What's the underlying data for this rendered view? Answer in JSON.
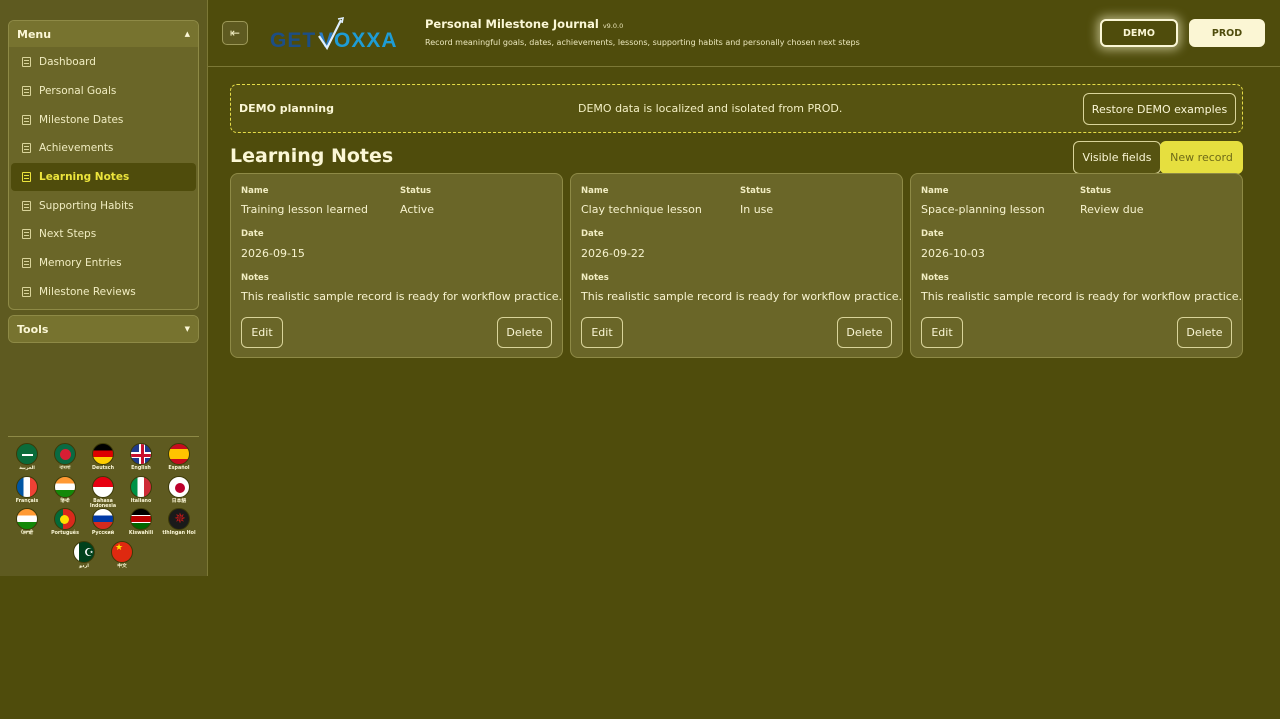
{
  "sidebar": {
    "menu_title": "Menu",
    "tools_title": "Tools",
    "items": [
      {
        "label": "Dashboard"
      },
      {
        "label": "Personal Goals"
      },
      {
        "label": "Milestone Dates"
      },
      {
        "label": "Achievements"
      },
      {
        "label": "Learning Notes",
        "active": true
      },
      {
        "label": "Supporting Habits"
      },
      {
        "label": "Next Steps"
      },
      {
        "label": "Memory Entries"
      },
      {
        "label": "Milestone Reviews"
      }
    ],
    "languages": [
      {
        "label": "العربية",
        "icon": "flag-saudi-arabia-icon"
      },
      {
        "label": "বাংলা",
        "icon": "flag-bangladesh-icon"
      },
      {
        "label": "Deutsch",
        "icon": "flag-germany-icon"
      },
      {
        "label": "English",
        "icon": "flag-uk-icon"
      },
      {
        "label": "Español",
        "icon": "flag-spain-icon"
      },
      {
        "label": "Français",
        "icon": "flag-france-icon"
      },
      {
        "label": "हिन्दी",
        "icon": "flag-india-icon"
      },
      {
        "label": "Bahasa Indonesia",
        "icon": "flag-indonesia-icon"
      },
      {
        "label": "Italiano",
        "icon": "flag-italy-icon"
      },
      {
        "label": "日本語",
        "icon": "flag-japan-icon"
      },
      {
        "label": "ਪੰਜਾਬੀ",
        "icon": "flag-india-icon"
      },
      {
        "label": "Português",
        "icon": "flag-portugal-icon"
      },
      {
        "label": "Русский",
        "icon": "flag-russia-icon"
      },
      {
        "label": "Kiswahili",
        "icon": "flag-kenya-icon"
      },
      {
        "label": "tlhIngan Hol",
        "icon": "flag-klingon-icon"
      },
      {
        "label": "اردو",
        "icon": "flag-pakistan-icon"
      },
      {
        "label": "中文",
        "icon": "flag-china-icon"
      }
    ]
  },
  "header": {
    "logo_text": "GETVOXXA",
    "title": "Personal Milestone Journal",
    "version": "v9.0.0",
    "subtitle": "Record meaningful goals, dates, achievements, lessons, supporting habits and personally chosen next steps",
    "demo_label": "DEMO",
    "prod_label": "PROD"
  },
  "banner": {
    "title": "DEMO planning",
    "message": "DEMO data is localized and isolated from PROD.",
    "restore_label": "Restore DEMO examples"
  },
  "section": {
    "title": "Learning Notes",
    "visible_fields_label": "Visible fields",
    "new_record_label": "New record"
  },
  "field_labels": {
    "name": "Name",
    "status": "Status",
    "date": "Date",
    "notes": "Notes"
  },
  "cards": [
    {
      "name": "Training lesson learned",
      "status": "Active",
      "date": "2026-09-15",
      "notes": "This realistic sample record is ready for workflow practice.",
      "edit": "Edit",
      "delete": "Delete"
    },
    {
      "name": "Clay technique lesson",
      "status": "In use",
      "date": "2026-09-22",
      "notes": "This realistic sample record is ready for workflow practice.",
      "edit": "Edit",
      "delete": "Delete"
    },
    {
      "name": "Space-planning lesson",
      "status": "Review due",
      "date": "2026-10-03",
      "notes": "This realistic sample record is ready for workflow practice.",
      "edit": "Edit",
      "delete": "Delete"
    }
  ],
  "colors": {
    "background": "#4f4c0c",
    "accent": "#e6df3f",
    "card": "#6a6628"
  }
}
